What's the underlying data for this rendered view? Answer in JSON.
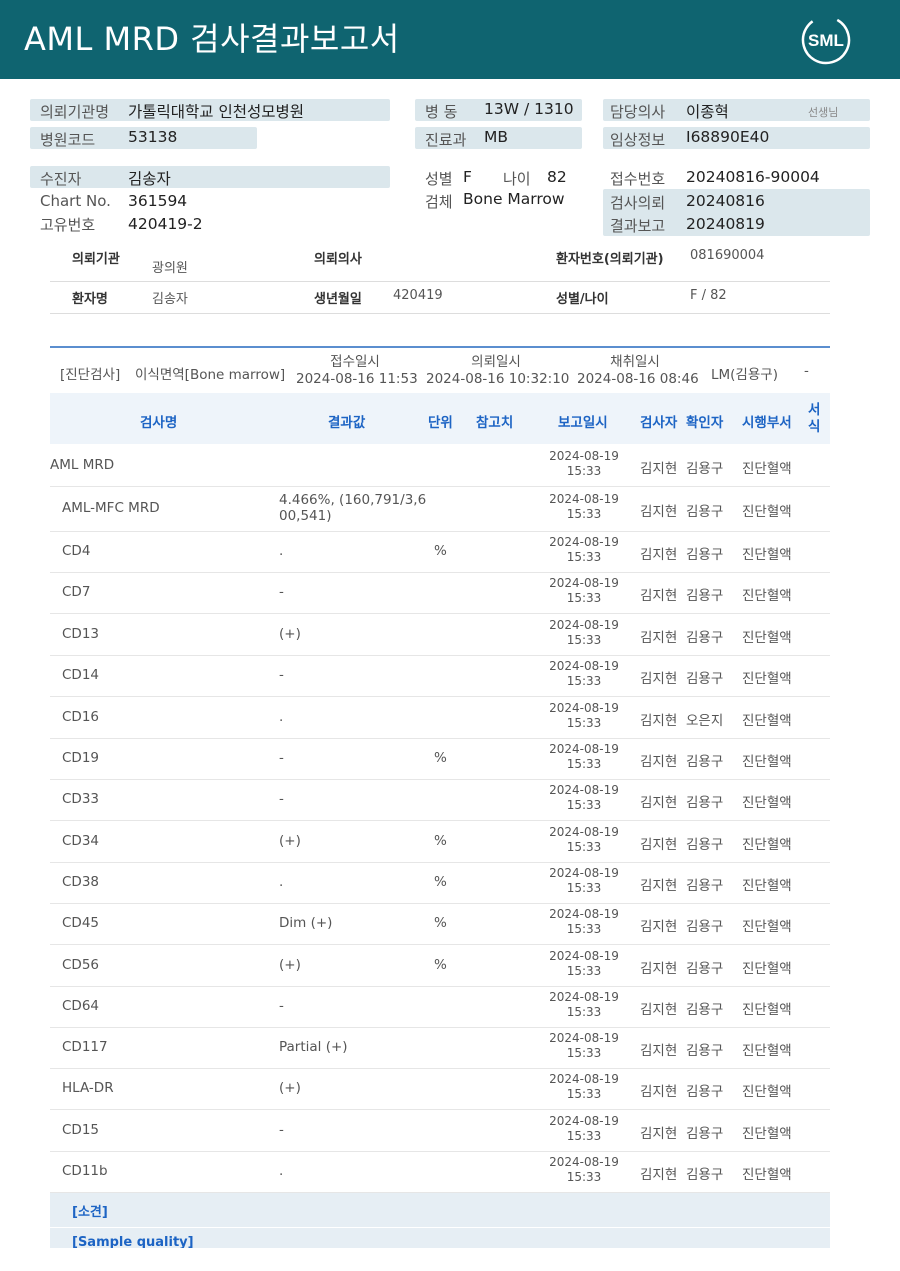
{
  "header": {
    "title": "AML  MRD 검사결과보고서",
    "logo_text": "SML"
  },
  "info": {
    "requesting_org": {
      "label": "의뢰기관명",
      "value": "가톨릭대학교 인천성모병원"
    },
    "hospital_code": {
      "label": "병원코드",
      "value": "53138"
    },
    "ward": {
      "label": "병  동",
      "value": "13W / 1310"
    },
    "department": {
      "label": "진료과",
      "value": "MB"
    },
    "doctor": {
      "label": "담당의사",
      "value": "이종혁",
      "suffix": "선생님"
    },
    "clinical_info": {
      "label": "임상정보",
      "value": "I68890E40"
    },
    "patient": {
      "label": "수진자",
      "value": "김송자"
    },
    "chart_no": {
      "label": "Chart No.",
      "value": "361594"
    },
    "unique_no": {
      "label": "고유번호",
      "value": "420419-2"
    },
    "sex": {
      "label": "성별",
      "value": "F"
    },
    "age": {
      "label": "나이",
      "value": "82"
    },
    "specimen": {
      "label": "검체",
      "value": "Bone Marrow"
    },
    "receipt_no": {
      "label": "접수번호",
      "value": "20240816-90004"
    },
    "test_request": {
      "label": "검사의뢰",
      "value": "20240816"
    },
    "result_report": {
      "label": "결과보고",
      "value": "20240819"
    }
  },
  "patient_table": {
    "row1": {
      "k1": "의뢰기관",
      "v1": "광의원",
      "k2": "의뢰의사",
      "k3": "환자번호(의뢰기관)",
      "v3": "081690004"
    },
    "row2": {
      "k1": "환자명",
      "v1": "김송자",
      "k2": "생년월일",
      "v2": "420419",
      "k3": "성별/나이",
      "v3": "F / 82"
    }
  },
  "specimen_row": {
    "category": "[진단검사]",
    "specimen": "이식면역[Bone marrow]",
    "receipt_label": "접수일시",
    "receipt_value": "2024-08-16 11:53",
    "request_label": "의뢰일시",
    "request_value": "2024-08-16 10:32:10",
    "collect_label": "채취일시",
    "collect_value": "2024-08-16 08:46",
    "lm": "LM(김용구)",
    "dash": "-"
  },
  "table": {
    "headers": {
      "name": "검사명",
      "result": "결과값",
      "unit": "단위",
      "ref": "참고치",
      "date": "보고일시",
      "tester": "검사자",
      "checker": "확인자",
      "dept": "시행부서",
      "form": "서식"
    },
    "rows": [
      {
        "name": "AML MRD",
        "result": "",
        "unit": "",
        "date": "2024-08-19",
        "time": "15:33",
        "tester": "김지현",
        "checker": "김용구",
        "dept": "진단혈액"
      },
      {
        "name": "AML-MFC MRD",
        "result": "4.466%, (160,791/3,6",
        "result2": "00,541)",
        "unit": "",
        "date": "2024-08-19",
        "time": "15:33",
        "tester": "김지현",
        "checker": "김용구",
        "dept": "진단혈액"
      },
      {
        "name": "CD4",
        "result": ".",
        "unit": "%",
        "date": "2024-08-19",
        "time": "15:33",
        "tester": "김지현",
        "checker": "김용구",
        "dept": "진단혈액"
      },
      {
        "name": "CD7",
        "result": "-",
        "unit": "",
        "date": "2024-08-19",
        "time": "15:33",
        "tester": "김지현",
        "checker": "김용구",
        "dept": "진단혈액"
      },
      {
        "name": "CD13",
        "result": "(+)",
        "unit": "",
        "date": "2024-08-19",
        "time": "15:33",
        "tester": "김지현",
        "checker": "김용구",
        "dept": "진단혈액"
      },
      {
        "name": "CD14",
        "result": "-",
        "unit": "",
        "date": "2024-08-19",
        "time": "15:33",
        "tester": "김지현",
        "checker": "김용구",
        "dept": "진단혈액"
      },
      {
        "name": "CD16",
        "result": ".",
        "unit": "",
        "date": "2024-08-19",
        "time": "15:33",
        "tester": "김지현",
        "checker": "오은지",
        "dept": "진단혈액"
      },
      {
        "name": "CD19",
        "result": "-",
        "unit": "%",
        "date": "2024-08-19",
        "time": "15:33",
        "tester": "김지현",
        "checker": "김용구",
        "dept": "진단혈액"
      },
      {
        "name": "CD33",
        "result": "-",
        "unit": "",
        "date": "2024-08-19",
        "time": "15:33",
        "tester": "김지현",
        "checker": "김용구",
        "dept": "진단혈액"
      },
      {
        "name": "CD34",
        "result": "(+)",
        "unit": "%",
        "date": "2024-08-19",
        "time": "15:33",
        "tester": "김지현",
        "checker": "김용구",
        "dept": "진단혈액"
      },
      {
        "name": "CD38",
        "result": ".",
        "unit": "%",
        "date": "2024-08-19",
        "time": "15:33",
        "tester": "김지현",
        "checker": "김용구",
        "dept": "진단혈액"
      },
      {
        "name": "CD45",
        "result": "Dim (+)",
        "unit": "%",
        "date": "2024-08-19",
        "time": "15:33",
        "tester": "김지현",
        "checker": "김용구",
        "dept": "진단혈액"
      },
      {
        "name": "CD56",
        "result": "(+)",
        "unit": "%",
        "date": "2024-08-19",
        "time": "15:33",
        "tester": "김지현",
        "checker": "김용구",
        "dept": "진단혈액"
      },
      {
        "name": "CD64",
        "result": "-",
        "unit": "",
        "date": "2024-08-19",
        "time": "15:33",
        "tester": "김지현",
        "checker": "김용구",
        "dept": "진단혈액"
      },
      {
        "name": "CD117",
        "result": "Partial (+)",
        "unit": "",
        "date": "2024-08-19",
        "time": "15:33",
        "tester": "김지현",
        "checker": "김용구",
        "dept": "진단혈액"
      },
      {
        "name": "HLA-DR",
        "result": "(+)",
        "unit": "",
        "date": "2024-08-19",
        "time": "15:33",
        "tester": "김지현",
        "checker": "김용구",
        "dept": "진단혈액"
      },
      {
        "name": "CD15",
        "result": "-",
        "unit": "",
        "date": "2024-08-19",
        "time": "15:33",
        "tester": "김지현",
        "checker": "김용구",
        "dept": "진단혈액"
      },
      {
        "name": "CD11b",
        "result": ".",
        "unit": "",
        "date": "2024-08-19",
        "time": "15:33",
        "tester": "김지현",
        "checker": "김용구",
        "dept": "진단혈액"
      }
    ]
  },
  "sections": {
    "opinion": "[소견]",
    "sample_quality": "[Sample quality]"
  },
  "colors": {
    "header_bg": "#0f6470",
    "band": "#dbe7ec",
    "accent_blue": "#1d64c4"
  }
}
